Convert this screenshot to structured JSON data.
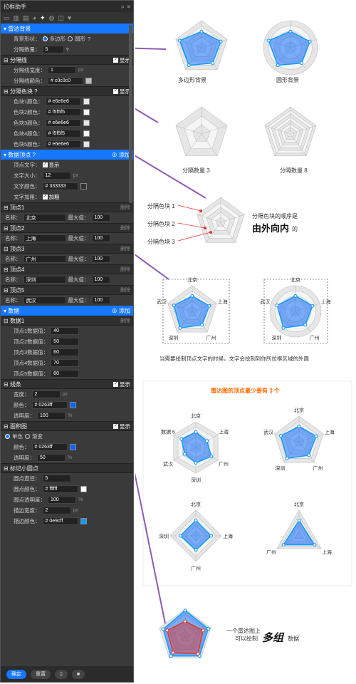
{
  "panel": {
    "title": "拉框助手",
    "title_icons": "»",
    "sections": {
      "radar_bg": {
        "label": "雷达背景",
        "shape_label": "背景形状：",
        "shape_opt1": "多边形",
        "shape_opt2": "圆形",
        "count_label": "分隔数量：",
        "count": "5"
      },
      "divider": {
        "label": "分隔线",
        "show": "显示",
        "width_label": "分隔线宽度：",
        "width": "1",
        "width_unit": "px",
        "color_label": "分隔线颜色：",
        "color": "# c0c0c0"
      },
      "blocks": {
        "label": "分隔色块",
        "show": "显示",
        "items": [
          {
            "label": "色块1颜色：",
            "value": "# e6e6e6",
            "color": "#e6e6e6"
          },
          {
            "label": "色块2颜色：",
            "value": "# f5f5f5",
            "color": "#f5f5f5"
          },
          {
            "label": "色块3颜色：",
            "value": "# e6e6e6",
            "color": "#e6e6e6"
          },
          {
            "label": "色块4颜色：",
            "value": "# f5f5f5",
            "color": "#f5f5f5"
          },
          {
            "label": "色块5颜色：",
            "value": "# e6e6e6",
            "color": "#e6e6e6"
          }
        ]
      },
      "vertices": {
        "label": "数据顶点",
        "add": "添加",
        "text_label": "顶点文字：",
        "text_show": "显示",
        "size_label": "文字大小：",
        "size": "12",
        "size_unit": "px",
        "color_label": "文字颜色：",
        "color": "# 333333",
        "bold_label": "文字加粗：",
        "bold": "加粗",
        "items": [
          {
            "title": "顶点1",
            "name": "北京",
            "max": "100"
          },
          {
            "title": "顶点2",
            "name": "上海",
            "max": "100"
          },
          {
            "title": "顶点3",
            "name": "广州",
            "max": "100"
          },
          {
            "title": "顶点4",
            "name": "深圳",
            "max": "100"
          },
          {
            "title": "顶点5",
            "name": "武汉",
            "max": "100"
          }
        ],
        "name_label": "名称：",
        "max_label": "最大值：",
        "del": "删除"
      },
      "data": {
        "label": "数据",
        "add": "添加",
        "set_title": "数据1",
        "del": "删除",
        "values": [
          {
            "label": "顶点1数据值：",
            "v": "40"
          },
          {
            "label": "顶点2数据值：",
            "v": "50"
          },
          {
            "label": "顶点3数据值：",
            "v": "60"
          },
          {
            "label": "顶点4数据值：",
            "v": "70"
          },
          {
            "label": "顶点5数据值：",
            "v": "80"
          }
        ],
        "line": {
          "label": "线条",
          "show": "显示",
          "width_label": "宽度：",
          "width": "2",
          "unit": "px",
          "color_label": "颜色：",
          "color": "# 0263ff",
          "alpha_label": "透明度：",
          "alpha": "100",
          "pct": "%"
        },
        "area": {
          "label": "面积图",
          "show": "显示",
          "mode1": "单色",
          "mode2": "渐变",
          "color_label": "颜色：",
          "color": "# 0263ff",
          "alpha_label": "透明度：",
          "alpha": "50",
          "pct": "%"
        },
        "marker": {
          "label": "标记小圆点",
          "r_label": "圆点直径：",
          "r": "5",
          "fill_label": "圆点颜色：",
          "fill": "# ffffff",
          "alpha_label": "圆点透明度：",
          "alpha": "100",
          "pct": "%",
          "bw_label": "描边宽度：",
          "bw": "2",
          "bw_unit": "px",
          "bc_label": "描边颜色：",
          "bc": "# 0e9cff"
        }
      }
    },
    "footer": {
      "ok": "确定",
      "reset": "重置"
    }
  },
  "demo": {
    "cap_poly": "多边形背景",
    "cap_circle": "圆形背景",
    "cap_split3": "分隔数量 3",
    "cap_split8": "分隔数量 8",
    "block1": "分隔色块 1",
    "block2": "分隔色块 2",
    "block3": "分隔色块 3",
    "order_note": "分隔色块的顺序是",
    "order_big": "由外向内",
    "order_tail": "的",
    "labels": [
      "北京",
      "上海",
      "广州",
      "深圳",
      "武汉"
    ],
    "label6": "数据 6",
    "text_note": "当需要绘制顶点文字的时候，文字会绘制到你所拉框区域的外面",
    "min_note": "雷达图的顶点最少要有 3 个",
    "multi1": "一个雷达图上",
    "multi2": "可以绘制",
    "multi_big": "多组",
    "multi_tail": "数据"
  },
  "colors": {
    "accent": "#1677ff",
    "fill": "#0263ff",
    "stroke": "#0e9cff",
    "purple": "#8e5bb5",
    "orange": "#ff6a00"
  }
}
